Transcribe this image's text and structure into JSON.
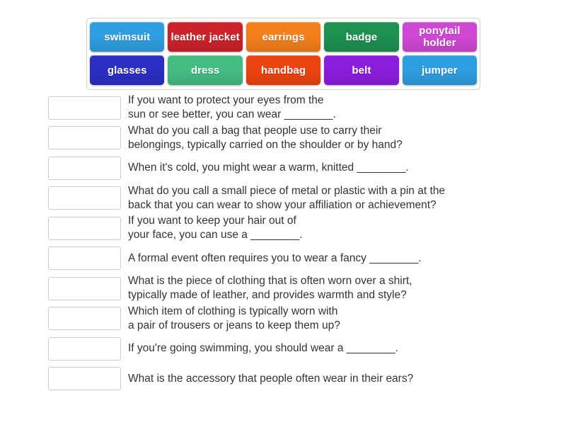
{
  "activity": {
    "type": "match-up",
    "background_color": "#ffffff",
    "text_color": "#333333"
  },
  "word_bank": {
    "border_color": "#d9d2c6",
    "rows": [
      [
        {
          "label": "swimsuit",
          "color": "#2f9ee0"
        },
        {
          "label": "leather\njacket",
          "color": "#cc2229"
        },
        {
          "label": "earrings",
          "color": "#f37f1b"
        },
        {
          "label": "badge",
          "color": "#1d9150"
        },
        {
          "label": "ponytail\nholder",
          "color": "#cf48d4"
        }
      ],
      [
        {
          "label": "glasses",
          "color": "#2b2fc4"
        },
        {
          "label": "dress",
          "color": "#44bd83"
        },
        {
          "label": "handbag",
          "color": "#ec4410"
        },
        {
          "label": "belt",
          "color": "#8c1ddd"
        },
        {
          "label": "jumper",
          "color": "#2f9ee0"
        }
      ]
    ]
  },
  "questions": [
    {
      "drop_placeholder": "",
      "text": "If you want to protect your eyes from the\nsun or see better, you can wear ________."
    },
    {
      "drop_placeholder": "",
      "text": "What do you call a bag that people use to carry their\nbelongings, typically carried on the shoulder or by hand?"
    },
    {
      "drop_placeholder": "",
      "text": "When it's cold, you might wear a warm, knitted ________."
    },
    {
      "drop_placeholder": "",
      "text": "What do you call a small piece of metal or plastic with a pin at the\nback that you can wear to show your affiliation or achievement?"
    },
    {
      "drop_placeholder": "",
      "text": "If you want to keep your hair out of\nyour face, you can use a ________."
    },
    {
      "drop_placeholder": "",
      "text": "A formal event often requires you to wear a fancy ________."
    },
    {
      "drop_placeholder": "",
      "text": "What is the piece of clothing that is often worn over a shirt,\ntypically made of leather, and provides warmth and style?"
    },
    {
      "drop_placeholder": "",
      "text": "Which item of clothing is typically worn with\na pair of trousers or jeans to keep them up?"
    },
    {
      "drop_placeholder": "",
      "text": "If you're going swimming, you should wear a ________."
    },
    {
      "drop_placeholder": "",
      "text": "What is the accessory that people often wear in their ears?"
    }
  ]
}
